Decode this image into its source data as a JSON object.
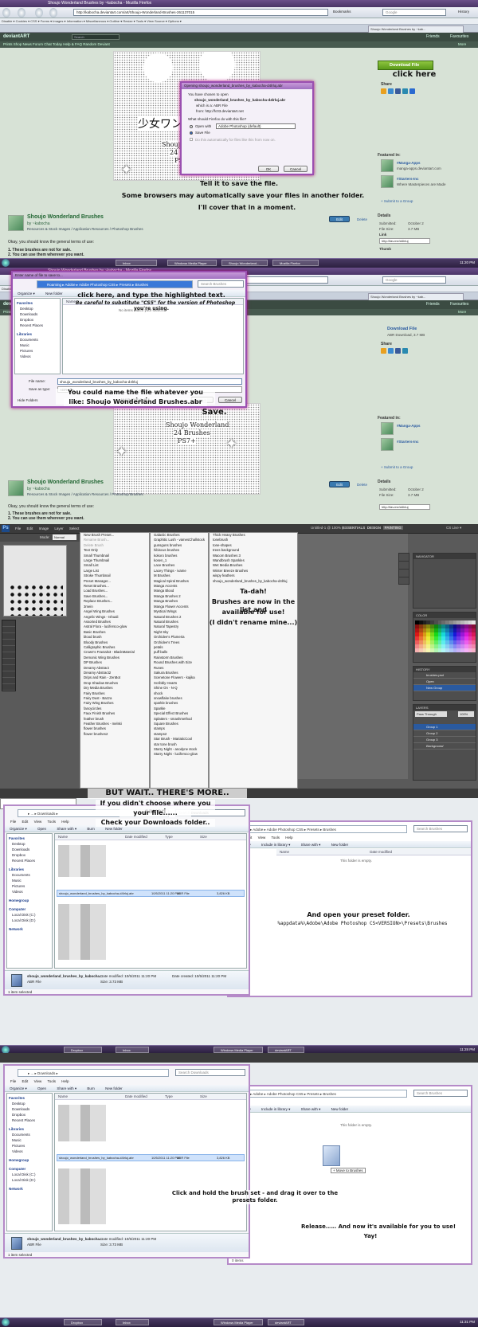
{
  "browser": {
    "window_title": "Shoujo Wonderland Brushes by ~kabocha - Mozilla Firefox",
    "address": "http://kabocha.deviantart.com/art/Shoujo-Wonderland-Brushes-261137015",
    "search_placeholder": "Google",
    "nav_labels": [
      "Back",
      "Forward",
      "Reload",
      "Stop",
      "Home"
    ],
    "bookmarks_label": "Bookmarks",
    "history_label": "History",
    "bookmark_bar": "Disable ▾  Cookies ▾  CSS ▾  Forms ▾  Images ▾  Information ▾  Miscellaneous ▾  Outline ▾  Resize ▾  Tools ▾  View Source ▾  Options ▾",
    "tab_label": "Shoujo Wonderland Brushes by ~kab..."
  },
  "deviantart": {
    "logo": "deviantART",
    "search_placeholder": "Search",
    "nav": "Prints Shop     News     Forum     Chat     Today     Help & FAQ     Random Deviant",
    "more": "More",
    "friends": "Friends",
    "favourites": "Favourites",
    "download_label": "Download File",
    "download_meta": "ABR Download, 3.7 MB",
    "share_label": "Share",
    "featured_label": "Featured in:",
    "groups": [
      {
        "name": "#Manga-Apps",
        "url": "manga-apps.deviantart.com"
      },
      {
        "name": "#Starters-Inc",
        "url": "Where Masterpieces are Made"
      }
    ],
    "submit_group": "+ Submit to a Group",
    "details_label": "Details",
    "details": [
      {
        "k": "Submitted:",
        "v": "October 2"
      },
      {
        "k": "File Size:",
        "v": "3.7 MB"
      }
    ],
    "link_label": "Link",
    "thumb_label": "Thumb",
    "link_value": "http://fav.me/d4lrluj",
    "title": "Shoujo Wonderland Brushes",
    "by": "by ~kabocha",
    "breadcrumb": "Resources & Stock Images / Application Resources / Photoshop Brushes",
    "edit_label": "Edit",
    "delete_label": "Delete",
    "body_intro": "Okay, you should know the general terms of use:",
    "terms": [
      "1. These brushes are not for sale.",
      "2. You can use them wherever you want."
    ],
    "art_text": "少女ワン",
    "art_caption_1": "Shoujo",
    "art_caption_2": "24 Brushes",
    "art_caption_3": "PS7+",
    "art_title_p2": "Shoujo Wonderland"
  },
  "open_dialog": {
    "title": "Opening shoujo_wonderland_brushes_by_kabocha-d4lrluj.abr",
    "chosen": "You have chosen to open",
    "filename": "shoujo_wonderland_brushes_by_kabocha-d4lrluj.abr",
    "which_is": "which is a: ABR File",
    "from": "from: http://fc03.deviantart.net",
    "question": "What should Firefox do with this file?",
    "open_with": "Open with",
    "open_with_app": "Adobe Photoshop (default)",
    "save_file": "Save File",
    "auto": "Do this automatically for files like this from now on.",
    "ok": "OK",
    "cancel": "Cancel"
  },
  "save_dialog": {
    "title": "Enter name of file to save to...",
    "path": "Roaming ▸ Adobe ▸ Adobe Photoshop CS5 ▸ Presets ▸ Brushes",
    "search": "Search Brushes",
    "organize": "Organize ▾",
    "new_folder": "New folder",
    "col_name": "Name",
    "empty_note": "No items match your search.",
    "nav_items": [
      "Favorites",
      "Desktop",
      "Downloads",
      "Dropbox",
      "Recent Places",
      "Libraries",
      "Documents",
      "Music",
      "Pictures",
      "Videos"
    ],
    "file_name_label": "File name:",
    "file_name_value": "shoujo_wonderland_brushes_by_kabocha-d4lrluj",
    "save_type_label": "Save as type:",
    "save_type_value": "ABR File",
    "hide_folders": "Hide Folders",
    "save": "Save",
    "cancel": "Cancel"
  },
  "photoshop": {
    "title": "Untitled-1 @ 100% (...",
    "menu": [
      "File",
      "Edit",
      "Image",
      "Layer",
      "Select"
    ],
    "mode_label": "Mode:",
    "mode_value": "Normal",
    "workspace": [
      "ESSENTIALS",
      "DESIGN",
      "PAINTING"
    ],
    "cs_live": "CS Live ▾",
    "menu_col1": [
      "New Brush Preset...",
      "Rename Brush...",
      "Delete Brush",
      "Text Only",
      "Small Thumbnail",
      "Large Thumbnail",
      "Small List",
      "Large List",
      "Stroke Thumbnail",
      "Preset Manager...",
      "Reset Brushes...",
      "Load Brushes...",
      "Save Brushes...",
      "Replace Brushes...",
      "3mein",
      "Angel Wing Brushes",
      "Angelic Wings - Ishuali",
      "Assorted Brushes",
      "Astral Flora - lucifersco-glow",
      "Basic Brushes",
      "blood brush",
      "Bloody Brushes",
      "Calligraphic Brushes",
      "Crown's Fractals3 - BlackMaterial",
      "Demonic Wing Brushes",
      "DP Brushes",
      "Dreamy Abstract",
      "Dreamy Abstract2",
      "Drips and Rain - ZenBot",
      "Drop Shadow Brushes",
      "Dry Media Brushes",
      "Fairy Brushes",
      "Fairy Dust - Bazza",
      "Fairy Wing Brushes",
      "fancycircles",
      "Faux Finish Brushes",
      "feather brush",
      "Feather Brushes - melski",
      "flower brushes",
      "flower brushes2"
    ],
    "menu_col2": [
      "Galactic Brushes",
      "Graphitic Lush - vamesChallstock",
      "gunsguns brushes",
      "hibiscus brushes",
      "kokoro brushes",
      "kosen_1",
      "Lace Brushes",
      "Lacey Things - ivame",
      "M Brushes",
      "Magical Spiral Brushes",
      "Manga Accents",
      "Manga Blood",
      "Manga Brushes 2",
      "Manga Brushes",
      "Manga Flower Accents",
      "Mystical Wings",
      "Natural Brushes 2",
      "Natural Brushes",
      "Natural Tapestry",
      "Night Sky",
      "Orchidee's Plumeria",
      "Orchidee's Trees",
      "petals",
      "puff balls",
      "Rainstorm Brushes",
      "Round Brushes with Size",
      "Runes",
      "Sakura Brushes",
      "Scenetone Flowers - kajika",
      "Scribbly Hearts",
      "Shine On - N-Q",
      "shock",
      "snowflake brushes",
      "sparkle brushes",
      "Sparkle",
      "Special Effect Brushes",
      "Splatters - smashmethod",
      "Square Brushes",
      "stamps",
      "stamps2",
      "Star Brush - MariaticCool",
      "star tone brush",
      "Starry Night - anodyne stock",
      "Starry Night - lucifersco-glow"
    ],
    "menu_col3": [
      "Thick Heavy Brushes",
      "tonebrush",
      "tone-shapes",
      "trees background",
      "Wacom Brushes 3",
      "Wandbrush Sparkles",
      "Wet Media Brushes",
      "Winter Breeze Brushes",
      "wispy feathers",
      "shoujo_wonderland_brushes_by_kabocha-d4lrluj"
    ],
    "panels": [
      "NAVIGATOR",
      "COLOR",
      "HISTORY",
      "LAYERS"
    ],
    "history": [
      "brushes.psd",
      "Open",
      "New Group"
    ],
    "layers_blend": "Pass Through",
    "layers_opacity": "100%",
    "layers": [
      "Group 1",
      "Group 2",
      "Group 3",
      "Background"
    ]
  },
  "explorer": {
    "path_dl": "▸ ... ▸ Downloads ▸",
    "search_dl": "Search Downloads",
    "menu": [
      "File",
      "Edit",
      "View",
      "Tools",
      "Help"
    ],
    "cmd": [
      "Organize ▾",
      "Open",
      "Share with ▾",
      "Burn",
      "New folder"
    ],
    "cols": [
      "Name",
      "Date modified",
      "Type",
      "Size"
    ],
    "file_row": "shoujo_wonderland_brushes_by_kabocha-d4lrluj.abr",
    "file_date": "10/5/2011 11:20 PM",
    "file_type": "ABR File",
    "file_size": "3,826 KB",
    "nav": [
      "Favorites",
      "Desktop",
      "Downloads",
      "Dropbox",
      "Recent Places",
      "Libraries",
      "Documents",
      "Music",
      "Pictures",
      "Videos",
      "Homegroup",
      "Computer",
      "Local Disk (C:)",
      "Local Disk (D:)",
      "Network"
    ],
    "details_name": "shoujo_wonderland_brushes_by_kabocha...",
    "details_type": "ABR File",
    "details_modified": "Date modified: 10/5/2011 11:20 PM",
    "details_created": "Date created: 10/5/2011 11:20 PM",
    "details_size": "Size: 3.73 MB",
    "status": "1 item selected",
    "path_presets": "▸ Adobe ▸ Adobe Photoshop CS5 ▸ Presets ▸ Brushes",
    "search_presets": "Search Brushes",
    "cmd2": [
      "Organize ▾",
      "Include in library ▾",
      "Share with ▾",
      "New folder"
    ],
    "empty": "This folder is empty.",
    "items_0": "0 items",
    "move_tip": "+ Move to Brushes"
  },
  "taskbar": {
    "items": [
      "Inbox",
      "Windows Media Player",
      "Shoujo Wonderland...",
      "Mozilla Firefox"
    ],
    "items_ps": [
      "Dropbox",
      "Inbox",
      "Windows Media Player",
      "Adobe Photoshop",
      "deviantART"
    ],
    "clock_1": "11:20 PM",
    "clock_2": "11:22 PM",
    "clock_3": "11:27 PM",
    "clock_4": "11:28 PM",
    "clock_5": "11:31 PM"
  },
  "notes": {
    "click_here": "click here",
    "save_file_1": "Tell it to save the file.",
    "save_file_2": "Some browsers may automatically save your files in another folder.",
    "save_file_3": "I'll cover that in a moment.",
    "highlight_1": "click here, and type the highlighted text.",
    "highlight_2": "Be careful to substitute \"CS5\" for the version of Photoshop",
    "highlight_3": "you're using.",
    "name_1": "You could name the file whatever you wanted;",
    "name_2": "like: Shoujo Wonderland Brushes.abr",
    "save": "Save.",
    "tadah_1": "Ta-dah!",
    "tadah_2": "Brushes are now in the list and",
    "tadah_3": "available for use!",
    "tadah_4": "(I didn't rename mine...)",
    "wait": "BUT WAIT.. THERE'S MORE..",
    "choose_1": "If you didn't choose where you saved",
    "choose_2": "your file......",
    "downloads": "Check your Downloads folder..",
    "preset_1": "And open your preset folder.",
    "preset_2": "%appdata%\\Adobe\\Adobe Photoshop CS<VERSION>\\Presets\\Brushes",
    "drag": "Click and hold the brush set - and drag it over to the presets folder.",
    "release_1": "Release..... And now it's available for you to use!",
    "release_2": "Yay!"
  },
  "colors": {
    "accent": "#9a4fb0",
    "da_bg": "#d7e2d6",
    "download_green": "#6aaa2a",
    "taskbar": "#3a2c52"
  }
}
